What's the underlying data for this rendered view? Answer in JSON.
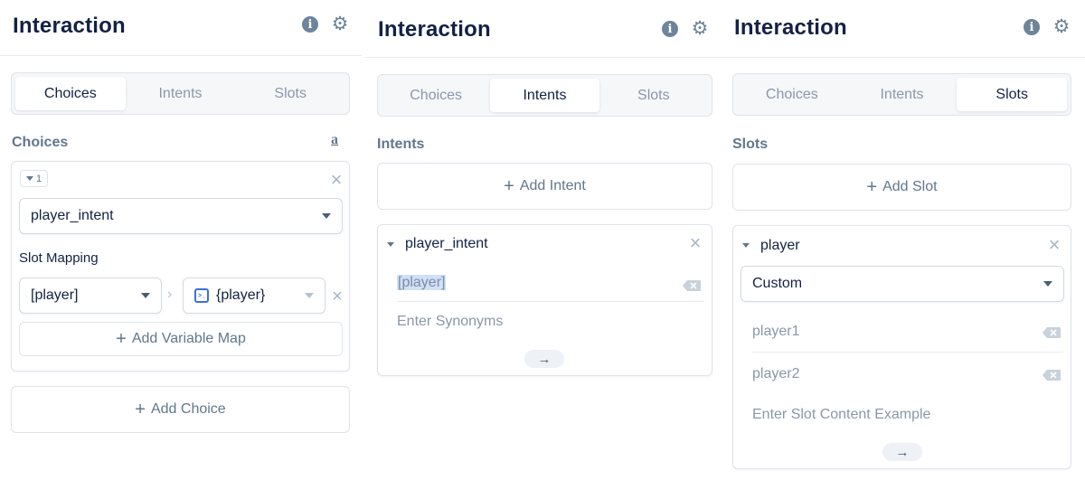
{
  "panel1": {
    "title": "Interaction",
    "tabs": [
      "Choices",
      "Intents",
      "Slots"
    ],
    "active_tab": "Choices",
    "section_label": "Choices",
    "choice": {
      "badge": "1",
      "intent_select": "player_intent",
      "slot_mapping_label": "Slot Mapping",
      "slot_select": "[player]",
      "variable_select": "{player}",
      "add_variable_map": "Add Variable Map"
    },
    "add_choice": "Add Choice"
  },
  "panel2": {
    "title": "Interaction",
    "tabs": [
      "Choices",
      "Intents",
      "Slots"
    ],
    "active_tab": "Intents",
    "section_label": "Intents",
    "add_intent": "Add Intent",
    "intent": {
      "name": "player_intent",
      "utterance": "[player]",
      "synonyms_placeholder": "Enter Synonyms",
      "submit_arrow": "→"
    }
  },
  "panel3": {
    "title": "Interaction",
    "tabs": [
      "Choices",
      "Intents",
      "Slots"
    ],
    "active_tab": "Slots",
    "section_label": "Slots",
    "add_slot": "Add Slot",
    "slot": {
      "name": "player",
      "type_select": "Custom",
      "values": [
        "player1",
        "player2"
      ],
      "example_placeholder": "Enter Slot Content Example",
      "submit_arrow": "→"
    }
  },
  "icons": {
    "info": "info-icon",
    "settings": "gear-icon",
    "amazon": "amazon-icon",
    "close": "close-icon",
    "backspace": "backspace-icon",
    "variable": "variable-icon"
  },
  "colors": {
    "title": "#132144",
    "muted": "#62778c",
    "border": "#dfe3ea",
    "variable_accent": "#3d6fd6",
    "selection": "#cfe0f7"
  }
}
